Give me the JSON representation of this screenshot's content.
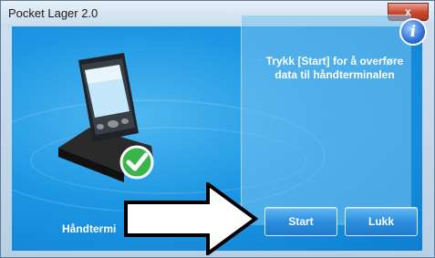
{
  "window": {
    "title": "Pocket Lager 2.0",
    "close_icon": "close-icon",
    "close_glyph": "x"
  },
  "main": {
    "info_icon": "info-icon",
    "info_glyph": "i",
    "message": "Trykk [Start] for å overføre data til håndterminalen",
    "device_label": "Håndtermi",
    "device_icon": "handheld-device-icon",
    "check_icon": "checkmark-icon",
    "start_label": "Start",
    "close_label": "Lukk",
    "arrow_icon": "arrow-right-icon"
  },
  "colors": {
    "accent": "#1d97e3",
    "check_green": "#39b54a"
  }
}
